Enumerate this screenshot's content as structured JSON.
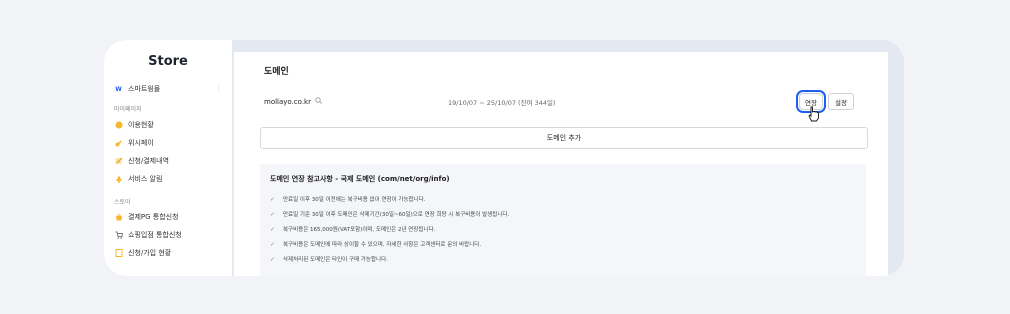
{
  "sidebar": {
    "brand": "Store",
    "items_top": [
      {
        "icon": "w-logo-icon",
        "label": "스마트윙몰"
      }
    ],
    "section_mypage": "마이페이지",
    "mypage_items": [
      {
        "icon": "coin-icon",
        "label": "이용현황"
      },
      {
        "icon": "key-icon",
        "label": "위시페이"
      },
      {
        "icon": "pencil-icon",
        "label": "신청/결제내역"
      },
      {
        "icon": "bell-icon",
        "label": "서비스 알림"
      }
    ],
    "section_store": "스토어",
    "store_items": [
      {
        "icon": "bag-icon",
        "label": "결제PG 통합신청"
      },
      {
        "icon": "cart-icon",
        "label": "쇼핑입점 통합신청"
      },
      {
        "icon": "document-icon",
        "label": "신청/가입 현황"
      }
    ]
  },
  "main": {
    "title": "도메인",
    "domain": "mollayo.co.kr",
    "period": "19/10/07 ~ 25/10/07 (잔여 344일)",
    "extend_label": "연장",
    "setting_label": "설정",
    "add_label": "도메인 추가",
    "notice_title": "도메인 연장 참고사항 - 국제 도메인 (com/net/org/info)",
    "notice_lines": [
      "만료일 이후 30일 이전에는 복구비용 없이 연장이 가능합니다.",
      "만료일 기준 30일 이후 도메인은 삭제기간(30일~60일)으로 연장 희망 시 복구비용이 발생됩니다.",
      "복구비용은 165,000원(VAT포함)이며, 도메인은 2년 연장됩니다.",
      "복구비용은 도메인에 따라 상이할 수 있으며, 자세한 사항은 고객센터로 문의 바랍니다.",
      "삭제처리된 도메인은 타인이 구매 가능합니다."
    ]
  },
  "colors": {
    "accent": "#1e5ef0",
    "background": "#f1f3f6",
    "panel": "#e4e8f0"
  }
}
